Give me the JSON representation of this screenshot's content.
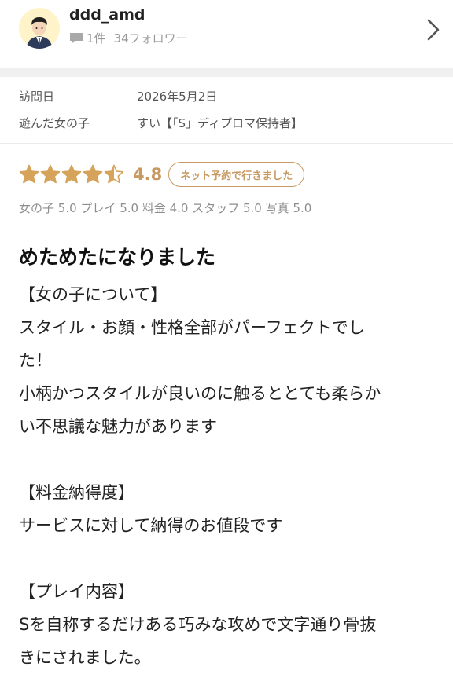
{
  "profile": {
    "username": "ddd_amd",
    "review_count": "1件",
    "followers": "34フォロワー",
    "icons": {
      "avatar": "user-avatar",
      "comment": "comment-icon",
      "chevron": "chevron-right-icon"
    }
  },
  "visit": {
    "date_label": "訪問日",
    "date_value": "2026年5月2日",
    "girl_label": "遊んだ女の子",
    "girl_value": "すい【「S」ディプロマ保持者】"
  },
  "rating": {
    "score_value": 4.8,
    "score_text": "4.8",
    "badge": "ネット予約で行きました",
    "star_color": "#d6a35b",
    "sub": [
      {
        "label": "女の子",
        "value": "5.0"
      },
      {
        "label": "プレイ",
        "value": "5.0"
      },
      {
        "label": "料金",
        "value": "4.0"
      },
      {
        "label": "スタッフ",
        "value": "5.0"
      },
      {
        "label": "写真",
        "value": "5.0"
      }
    ]
  },
  "review": {
    "title": "めためたになりました",
    "lines": [
      "【女の子について】",
      "スタイル・お顔・性格全部がパーフェクトでし",
      "た！",
      "小柄かつスタイルが良いのに触るととても柔らか",
      "い不思議な魅力があります",
      "",
      "【料金納得度】",
      "サービスに対して納得のお値段です",
      "",
      "【プレイ内容】",
      "Sを自称するだけある巧みな攻めで文字通り骨抜",
      "きにされました。"
    ]
  }
}
